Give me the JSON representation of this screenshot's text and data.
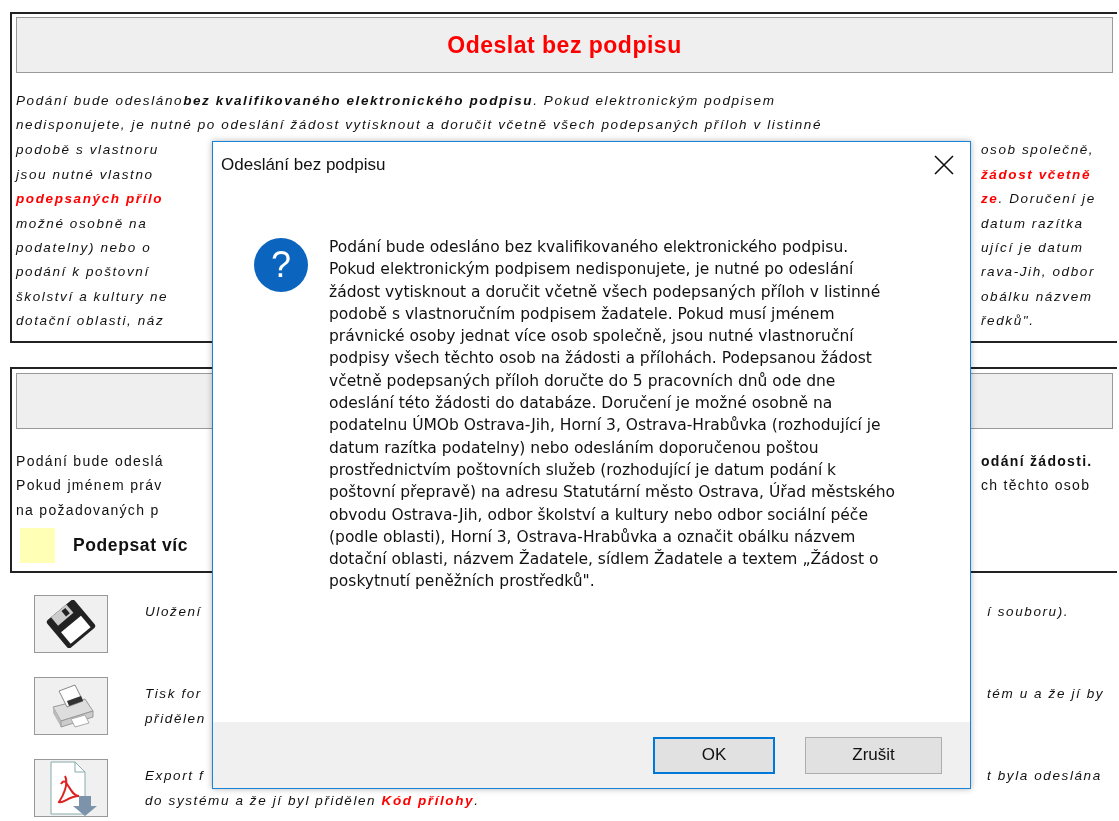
{
  "form": {
    "title": "Odeslat bez podpisu",
    "notice_lines": [
      {
        "kind": "full",
        "segments": [
          {
            "text": "Podání bude odesláno",
            "kind": "plain"
          },
          {
            "text": "bez kvalifikovaného elektronického podpisu",
            "kind": "bold"
          },
          {
            "text": ". Pokud elektronickým podpisem",
            "kind": "plain"
          }
        ]
      },
      {
        "kind": "full",
        "segments": [
          {
            "text": "nedisponujete, je nutné po odeslání žádost vytisknout a doručit včetně všech podepsaných příloh v listinné",
            "kind": "plain"
          }
        ]
      },
      {
        "kind": "split",
        "left": [
          {
            "text": "podobě s vlastnoru",
            "kind": "plain"
          }
        ],
        "right": [
          {
            "text": "osob společně,",
            "kind": "plain"
          }
        ]
      },
      {
        "kind": "split",
        "left": [
          {
            "text": "jsou nutné vlastno",
            "kind": "plain"
          }
        ],
        "right": [
          {
            "text": "žádost včetně",
            "kind": "red"
          }
        ]
      },
      {
        "kind": "split",
        "left": [
          {
            "text": "podepsaných přílo",
            "kind": "red"
          }
        ],
        "right": [
          {
            "text": "ze",
            "kind": "red"
          },
          {
            "text": ". Doručení je",
            "kind": "plain"
          }
        ]
      },
      {
        "kind": "split",
        "left": [
          {
            "text": "možné osobně na",
            "kind": "plain"
          }
        ],
        "right": [
          {
            "text": "datum razítka",
            "kind": "plain"
          }
        ]
      },
      {
        "kind": "split",
        "left": [
          {
            "text": "podatelny) nebo o",
            "kind": "plain"
          }
        ],
        "right": [
          {
            "text": "ující je datum",
            "kind": "plain"
          }
        ]
      },
      {
        "kind": "split",
        "left": [
          {
            "text": "podání k poštovní",
            "kind": "plain"
          }
        ],
        "right": [
          {
            "text": "rava-Jih, odbor",
            "kind": "plain"
          }
        ]
      },
      {
        "kind": "split",
        "left": [
          {
            "text": "školství a kultury ne",
            "kind": "plain"
          }
        ],
        "right": [
          {
            "text": "obálku názvem",
            "kind": "plain"
          }
        ]
      },
      {
        "kind": "split",
        "left": [
          {
            "text": "dotační oblasti, náz",
            "kind": "plain"
          }
        ],
        "right": [
          {
            "text": "ředků\".",
            "kind": "plain"
          }
        ]
      }
    ],
    "multi_signature_lines": [
      {
        "kind": "split",
        "left": [
          {
            "text": "Podání bude odeslá",
            "kind": "plain"
          }
        ],
        "right": [
          {
            "text": "odání žádosti.",
            "kind": "bold"
          }
        ]
      },
      {
        "kind": "split",
        "left": [
          {
            "text": "Pokud jménem práv",
            "kind": "plain"
          }
        ],
        "right": [
          {
            "text": "ch těchto osob",
            "kind": "plain"
          }
        ]
      },
      {
        "kind": "split",
        "left": [
          {
            "text": "na požadovaných p",
            "kind": "plain"
          }
        ]
      }
    ],
    "multi_signature_option": {
      "label": "Podepsat víc",
      "checked": false
    },
    "actions": [
      {
        "kind": "save",
        "lines": [
          {
            "kind": "split",
            "left": [
              {
                "text": "Uložení",
                "kind": "plain"
              }
            ],
            "right": [
              {
                "text": "í souboru).",
                "kind": "plain"
              }
            ]
          }
        ]
      },
      {
        "kind": "print",
        "lines": [
          {
            "kind": "split",
            "left": [
              {
                "text": "Tisk for",
                "kind": "plain"
              }
            ],
            "right": [
              {
                "text": "tém u a že jí by",
                "kind": "plain"
              }
            ]
          },
          {
            "kind": "split",
            "left": [
              {
                "text": "přidělen",
                "kind": "plain"
              }
            ]
          }
        ]
      },
      {
        "kind": "export",
        "lines": [
          {
            "kind": "split",
            "left": [
              {
                "text": "Export f",
                "kind": "plain"
              }
            ],
            "right": [
              {
                "text": "t byla odeslána",
                "kind": "plain"
              }
            ]
          },
          {
            "kind": "split",
            "left": [
              {
                "text": "do systému a že jí byl přidělen ",
                "kind": "plain"
              },
              {
                "text": "Kód přílohy",
                "kind": "red"
              },
              {
                "text": ".",
                "kind": "plain"
              }
            ]
          }
        ]
      }
    ]
  },
  "dialog": {
    "title": "Odeslání bez podpisu",
    "icon": "?",
    "message": "Podání bude odesláno bez kvalifikovaného elektronického podpisu. Pokud elektronickým podpisem nedisponujete, je nutné po odeslání žádost vytisknout a doručit včetně všech podepsaných příloh v listinné podobě s vlastnoručním podpisem žadatele. Pokud musí jménem právnické osoby jednat více osob společně, jsou nutné vlastnoruční podpisy všech těchto osob na žádosti a přílohách. Podepsanou žádost včetně podepsaných příloh doručte do 5 pracovních dnů ode dne odeslání této žádosti do databáze. Doručení je možné osobně na podatelnu ÚMOb Ostrava-Jih, Horní 3, Ostrava-Hrabůvka (rozhodující je datum razítka podatelny) nebo odesláním doporučenou poštou prostřednictvím poštovních služeb (rozhodující je datum podání k poštovní přepravě) na adresu Statutární město Ostrava, Úřad městského obvodu Ostrava-Jih, odbor školství a kultury nebo odbor sociální péče (podle oblasti), Horní 3, Ostrava-Hrabůvka a označit obálku názvem dotační oblasti, názvem Žadatele, sídlem Žadatele a textem „Žádost o poskytnutí peněžních prostředků\".",
    "buttons": [
      {
        "label": "OK",
        "default": true
      },
      {
        "label": "Zrušit",
        "default": false
      }
    ]
  }
}
